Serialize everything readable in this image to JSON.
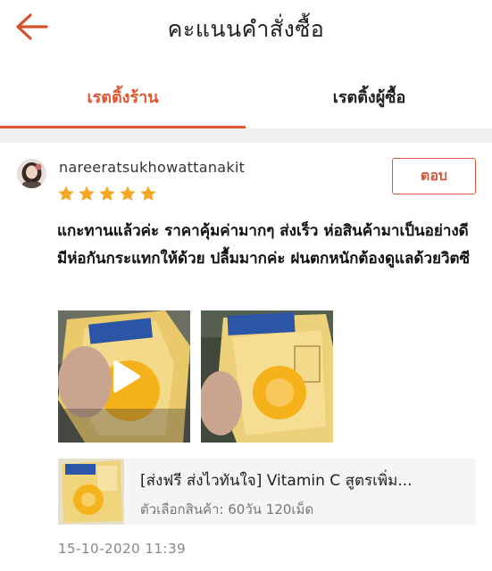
{
  "header": {
    "title": "คะแนนคำสั่งซื้อ",
    "back_icon": "arrow-left-icon"
  },
  "tabs": [
    {
      "label": "เรตติ้งร้าน",
      "active": true
    },
    {
      "label": "เรตติ้งผู้ซื้อ",
      "active": false
    }
  ],
  "review": {
    "username": "nareeratsukhowattanakit",
    "rating": 5,
    "reply_label": "ตอบ",
    "text": "แกะทานแล้วค่ะ ราคาคุ้มค่ามากๆ ส่งเร็ว ห่อสินค้ามาเป็นอย่างดี มีห่อกันกระแทกให้ด้วย ปลื้มมากค่ะ ฝนตกหนักต้องดูแลด้วยวิตซี",
    "media": [
      {
        "type": "video",
        "icon": "play-icon"
      },
      {
        "type": "image"
      }
    ],
    "product": {
      "title": "[ส่งฟรี ส่งไวทันใจ] Vitamin C สูตรเพิ่ม...",
      "variant": "ตัวเลือกสินค้า: 60วัน 120เม็ด"
    },
    "timestamp": "15-10-2020 11:39"
  },
  "colors": {
    "accent": "#e0562f",
    "star": "#f5a623",
    "divider": "#efefef"
  }
}
